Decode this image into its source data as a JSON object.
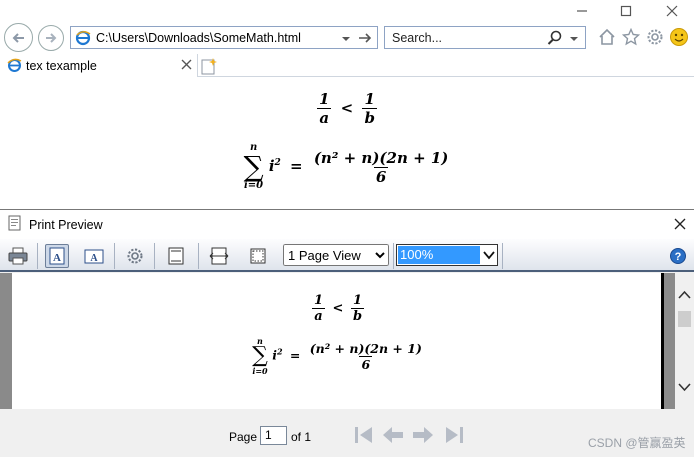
{
  "browser": {
    "address": "C:\\Users\\Downloads\\SomeMath.html",
    "search_placeholder": "Search...",
    "tab_title": "tex texample"
  },
  "math": {
    "frac1_num": "1",
    "frac1_den": "a",
    "lt": "<",
    "frac2_num": "1",
    "frac2_den": "b",
    "sum_upper": "n",
    "sum_lower": "i=0",
    "sum_symbol": "∑",
    "sum_term": "i",
    "sum_exp": "2",
    "equals": "=",
    "rhs_num": "(n² + n)(2n + 1)",
    "rhs_den": "6"
  },
  "print_preview": {
    "title": "Print Preview",
    "view_options": [
      "1 Page View"
    ],
    "view_selected": "1 Page View",
    "zoom_options": [
      "100%"
    ],
    "zoom_selected": "100%",
    "page_label": "Page",
    "page_value": "1",
    "page_of": "of 1"
  },
  "watermark": "CSDN @管赢盈英",
  "colors": {
    "zoom_highlight": "#3399ff",
    "toolbar_border": "#4c5f7a",
    "nav_gray": "#b6bcc6"
  }
}
